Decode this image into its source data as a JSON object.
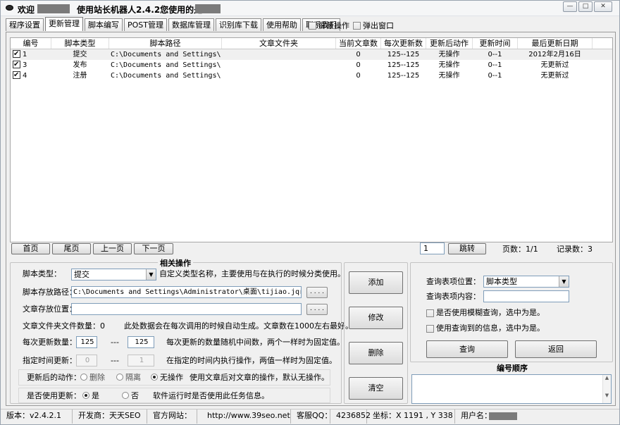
{
  "title": {
    "welcome": "欢迎",
    "main": "使用站长机器人2.4.2您使用的是："
  },
  "window_buttons": {
    "minimize": "—",
    "maximize": "□",
    "close": "✕"
  },
  "tabs": [
    {
      "label": "程序设置"
    },
    {
      "label": "更新管理"
    },
    {
      "label": "脚本编写"
    },
    {
      "label": "POST管理"
    },
    {
      "label": "数据库管理"
    },
    {
      "label": "识别库下载"
    },
    {
      "label": "使用帮助"
    },
    {
      "label": "联系我们"
    }
  ],
  "tab_options": {
    "block": "屏蔽操作",
    "popup": "弹出窗口"
  },
  "grid": {
    "columns": [
      "编号",
      "脚本类型",
      "脚本路径",
      "文章文件夹",
      "当前文章数",
      "每次更新数",
      "更新后动作",
      "更新时间",
      "最后更新日期"
    ],
    "rows": [
      {
        "id": "1",
        "type": "提交",
        "path": "C:\\Documents and Settings\\...",
        "folder": "",
        "count": "0",
        "per_update": "125--125",
        "action": "无操作",
        "time": "0--1",
        "last": "2012年2月16日"
      },
      {
        "id": "3",
        "type": "发布",
        "path": "C:\\Documents and Settings\\...",
        "folder": "",
        "count": "0",
        "per_update": "125--125",
        "action": "无操作",
        "time": "0--1",
        "last": "无更新过"
      },
      {
        "id": "4",
        "type": "注册",
        "path": "C:\\Documents and Settings\\...",
        "folder": "",
        "count": "0",
        "per_update": "125--125",
        "action": "无操作",
        "time": "0--1",
        "last": "无更新过"
      }
    ]
  },
  "pager": {
    "first": "首页",
    "last": "尾页",
    "prev": "上一页",
    "next": "下一页",
    "page_input": "1",
    "jump": "跳转",
    "page_count": "页数：1/1",
    "record_count": "记录数：3"
  },
  "related": {
    "title": "相关操作",
    "script_type_label": "脚本类型：",
    "script_type_value": "提交",
    "script_type_hint": "自定义类型名称，主要使用与在执行的时候分类使用。",
    "script_path_label": "脚本存放路径：",
    "script_path_value": "C:\\Documents and Settings\\Administrator\\桌面\\tijiao.jqr",
    "article_path_label": "文章存放位置：",
    "article_path_value": "",
    "browse": ". . . .",
    "file_count_label": "文章文件夹文件数量：0",
    "file_count_hint": "此处数据会在每次调用的时候自动生成。文章数在1000左右最好。",
    "per_update_label": "每次更新数量：",
    "per_update_min": "125",
    "per_update_max": "125",
    "range_sep": "---",
    "per_update_hint": "每次更新的数量随机中间数，两个一样时为固定值。",
    "time_label": "指定时间更新：",
    "time_min": "0",
    "time_max": "1",
    "time_hint": "在指定的时间内执行操作，两值一样时为固定值。",
    "after_label": "更新后的动作：",
    "after_options": [
      "删除",
      "隔离",
      "无操作"
    ],
    "after_hint": "使用文章后对文章的操作，默认无操作。",
    "use_label": "是否使用更新：",
    "use_options": [
      "是",
      "否"
    ],
    "use_hint": "软件运行时是否使用此任务信息。"
  },
  "actions": {
    "add": "添加",
    "modify": "修改",
    "delete": "删除",
    "clear": "清空"
  },
  "query": {
    "position_label": "查询表项位置：",
    "position_value": "脚本类型",
    "content_label": "查询表项内容：",
    "content_value": "",
    "fuzzy": "是否使用模糊查询，选中为是。",
    "use_found": "使用查询到的信息，选中为是。",
    "query_btn": "查询",
    "back_btn": "返回",
    "order_title": "编号顺序"
  },
  "status": {
    "version": "版本：v2.4.2.1",
    "developer": "开发商：天天SEO",
    "site_label": "官方网站：",
    "site_url": "http://www.39seo.net",
    "qq_label": "客服QQ：",
    "qq": "4236852",
    "coords": "坐标：X 1191 , Y 338",
    "user_label": "用户名："
  }
}
